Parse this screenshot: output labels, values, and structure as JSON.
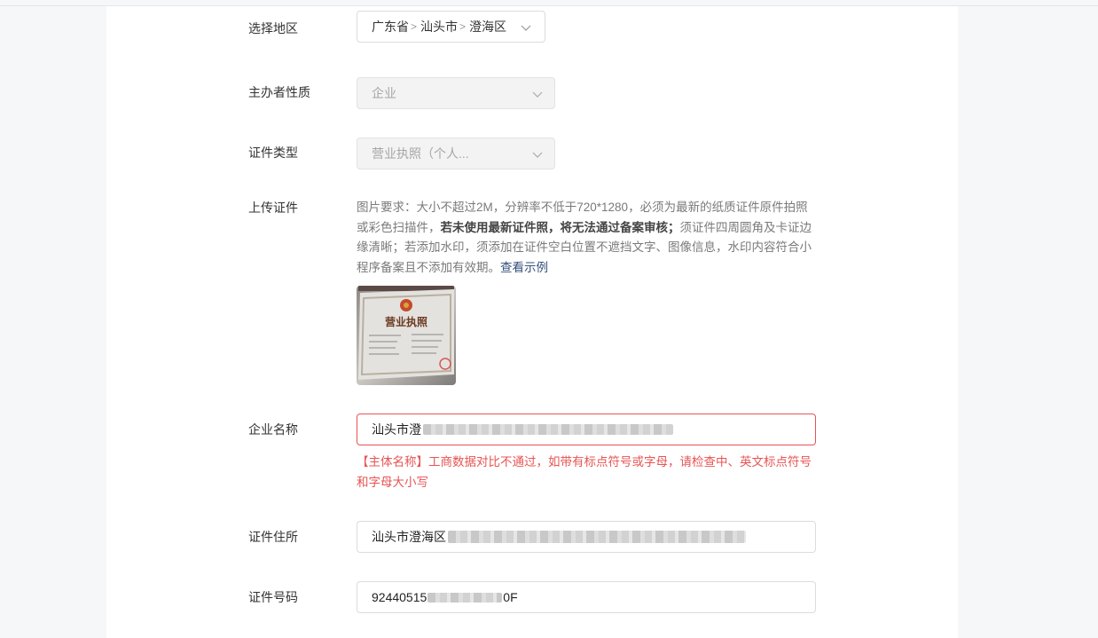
{
  "form": {
    "region": {
      "label": "选择地区",
      "province": "广东省",
      "city": "汕头市",
      "district": "澄海区"
    },
    "organizer_type": {
      "label": "主办者性质",
      "value": "企业"
    },
    "cert_type": {
      "label": "证件类型",
      "value": "营业执照（个人..."
    },
    "upload": {
      "label": "上传证件",
      "req_1": "图片要求：大小不超过2M，分辨率不低于720*1280，必须为最新的纸质证件原件拍照或彩色扫描件，",
      "req_bold": "若未使用最新证件照，将无法通过备案审核；",
      "req_2": "须证件四周圆角及卡证边缘清晰；若添加水印，须添加在证件空白位置不遮挡文字、图像信息，水印内容符合小程序备案且不添加有效期。",
      "example_link": "查看示例",
      "thumb_title": "营业执照"
    },
    "company_name": {
      "label": "企业名称",
      "value": "汕头市澄",
      "error": "【主体名称】工商数据对比不通过，如带有标点符号或字母，请检查中、英文标点符号和字母大小写"
    },
    "address": {
      "label": "证件住所",
      "value": "汕头市澄海区"
    },
    "cert_number": {
      "label": "证件号码",
      "value_prefix": "92440515",
      "value_suffix": "0F"
    }
  },
  "colors": {
    "error": "#e85454",
    "link": "#35507c",
    "disabled_bg": "#f3f3f3"
  }
}
